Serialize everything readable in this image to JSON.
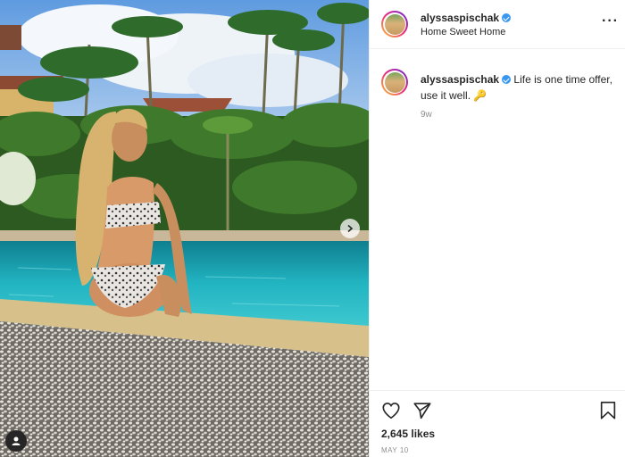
{
  "post": {
    "username": "alyssaspischak",
    "location": "Home Sweet Home",
    "caption": "Life is one time offer, use it well. 🔑",
    "time_ago": "9w",
    "likes": "2,645 likes",
    "date": "MAY 10",
    "more_glyph": "···"
  },
  "icons": {
    "like": "heart-icon",
    "share": "paper-plane-icon",
    "save": "bookmark-icon",
    "next": "chevron-right-icon",
    "tag": "user-icon",
    "verified": "verified-badge-icon"
  },
  "colors": {
    "accent": "#3897f0",
    "text": "#262626",
    "muted": "#8e8e8e",
    "border": "#efefef"
  }
}
